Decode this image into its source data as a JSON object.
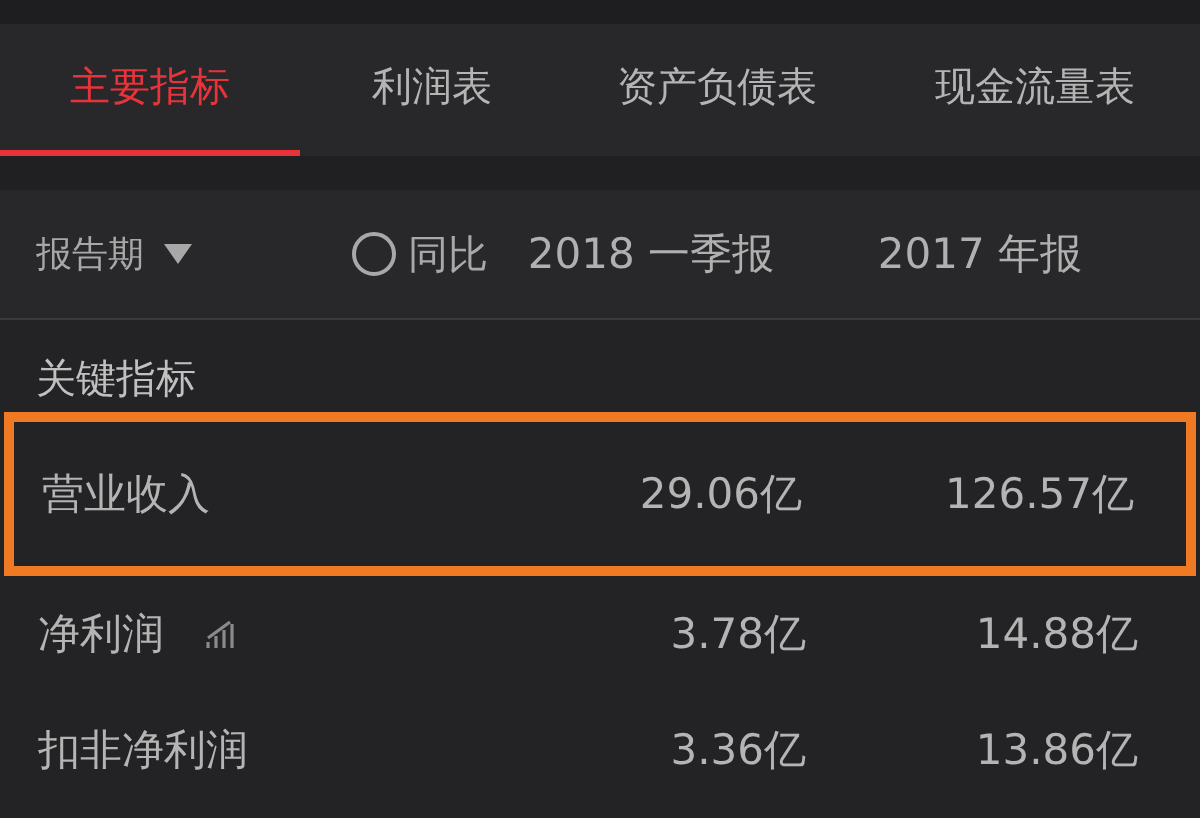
{
  "tabs": [
    {
      "label": "主要指标",
      "selected": true
    },
    {
      "label": "利润表",
      "selected": false
    },
    {
      "label": "资产负债表",
      "selected": false
    },
    {
      "label": "现金流量表",
      "selected": false
    }
  ],
  "filter": {
    "period_label": "报告期",
    "compare": {
      "label": "同比",
      "checked": false
    },
    "columns": [
      "2018 一季报",
      "2017 年报"
    ]
  },
  "section": {
    "title": "关键指标"
  },
  "rows": [
    {
      "name": "营业收入",
      "values": [
        "29.06亿",
        "126.57亿"
      ],
      "highlighted": true,
      "trend": false
    },
    {
      "name": "净利润",
      "values": [
        "3.78亿",
        "14.88亿"
      ],
      "highlighted": false,
      "trend": true
    },
    {
      "name": "扣非净利润",
      "values": [
        "3.36亿",
        "13.86亿"
      ],
      "highlighted": false,
      "trend": false
    }
  ]
}
